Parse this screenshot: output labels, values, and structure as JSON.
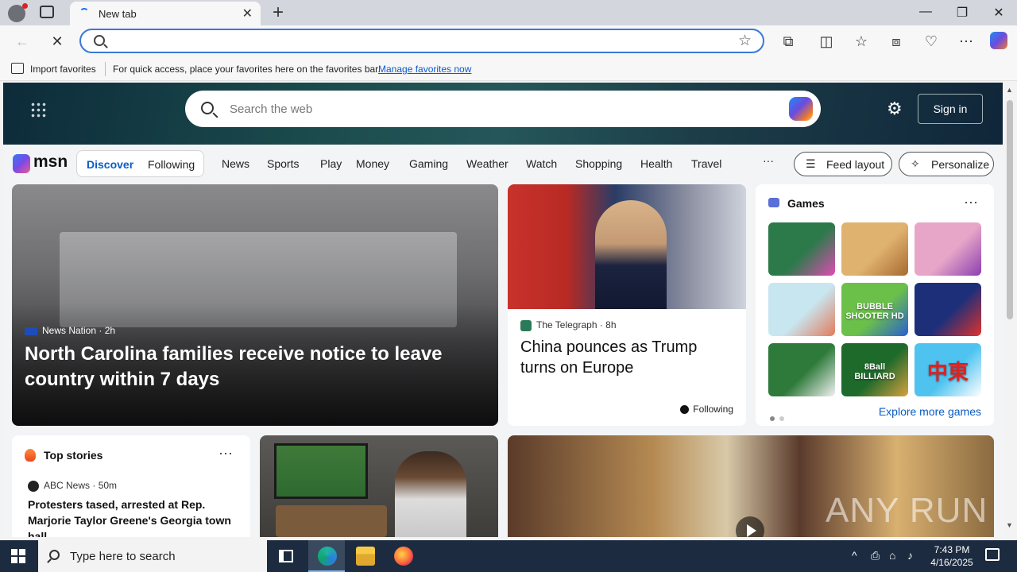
{
  "browser": {
    "tab_title": "New tab",
    "favorites_bar": {
      "import_label": "Import favorites",
      "message": "For quick access, place your favorites here on the favorites bar.",
      "manage_link": "Manage favorites now"
    }
  },
  "msn": {
    "search_placeholder": "Search the web",
    "sign_in": "Sign in",
    "logo_text": "msn",
    "segments": [
      "Discover",
      "Following"
    ],
    "nav_items": [
      "News",
      "Sports",
      "Play",
      "Money",
      "Gaming",
      "Weather",
      "Watch",
      "Shopping",
      "Health",
      "Travel"
    ],
    "more_label": "···",
    "feed_layout": "Feed layout",
    "personalize": "Personalize"
  },
  "lead_story": {
    "source": "News Nation",
    "age": "2h",
    "headline": "North Carolina families receive notice to leave country within 7 days"
  },
  "story2": {
    "source": "The Telegraph",
    "age": "8h",
    "headline": "China pounces as Trump turns on Europe",
    "following": "Following"
  },
  "games": {
    "title": "Games",
    "explore": "Explore more games",
    "tiles": [
      {
        "name": "jewel-game",
        "color": "#2c7a4a",
        "color2": "#e04bb5"
      },
      {
        "name": "wood-screw-game",
        "color": "#e0b270",
        "color2": "#a66a30"
      },
      {
        "name": "makeup-game",
        "color": "#e7a6c8",
        "color2": "#8b3fb0"
      },
      {
        "name": "doctor-game",
        "color": "#c8e6f0",
        "color2": "#e27b5a"
      },
      {
        "name": "bubble-shooter-game",
        "color": "#6bc04a",
        "color2": "#2a5fd0",
        "label": "BUBBLE SHOOTER HD"
      },
      {
        "name": "block-puzzle-game",
        "color": "#1e2f7a",
        "color2": "#e0322b"
      },
      {
        "name": "mahjong-solitaire-game",
        "color": "#2e7a3a",
        "color2": "#f2f2f2"
      },
      {
        "name": "8-ball-billiard-game",
        "color": "#1e6a2a",
        "color2": "#d8a040",
        "label": "8Ball BILLIARD"
      },
      {
        "name": "mahjong-tiles-game",
        "color": "#4fc3f0",
        "color2": "#ffffff",
        "label": "中東"
      }
    ]
  },
  "top_stories": {
    "title": "Top stories",
    "source": "ABC News",
    "age": "50m",
    "headline": "Protesters tased, arrested at Rep. Marjorie Taylor Greene's Georgia town hall"
  },
  "watermark": "ANY RUN",
  "taskbar": {
    "search_placeholder": "Type here to search",
    "time": "7:43 PM",
    "date": "4/16/2025"
  }
}
